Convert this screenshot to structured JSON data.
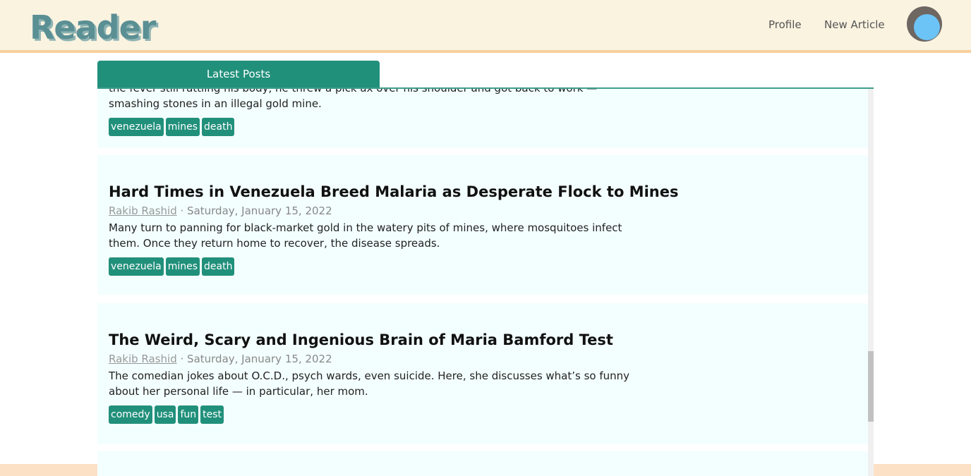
{
  "header": {
    "logo": "Reader",
    "nav": {
      "profile": "Profile",
      "new_article": "New Article"
    }
  },
  "tabs": {
    "latest": "Latest Posts"
  },
  "posts": [
    {
      "description": "the fever still rattling his body, he threw a pick ax over his shoulder and got back to work — smashing stones in an illegal gold mine.",
      "tags": [
        "venezuela",
        "mines",
        "death"
      ]
    },
    {
      "title": "Hard Times in Venezuela Breed Malaria as Desperate Flock to Mines",
      "author": "Rakib Rashid",
      "date": "· Saturday, January 15, 2022",
      "description": "Many turn to panning for black-market gold in the watery pits of mines, where mosquitoes infect them. Once they return home to recover, the disease spreads.",
      "tags": [
        "venezuela",
        "mines",
        "death"
      ]
    },
    {
      "title": "The Weird, Scary and Ingenious Brain of Maria Bamford Test",
      "author": "Rakib Rashid",
      "date": "· Saturday, January 15, 2022",
      "description": "The comedian jokes about O.C.D., psych wards, even suicide. Here, she discusses what’s so funny about her personal life — in particular, her mom.",
      "tags": [
        "comedy",
        "usa",
        "fun",
        "test"
      ]
    }
  ]
}
